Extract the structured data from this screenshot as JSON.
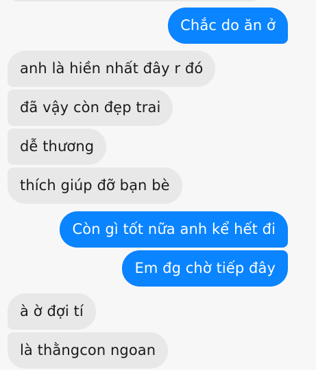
{
  "messages": [
    {
      "side": "outgoing",
      "text": "Chắc do ăn ở"
    },
    {
      "side": "incoming",
      "text": "anh là hiền nhất đây r đó"
    },
    {
      "side": "incoming",
      "text": "đã vậy còn đẹp trai"
    },
    {
      "side": "incoming",
      "text": "dễ thương"
    },
    {
      "side": "incoming",
      "text": "thích giúp đỡ bạn bè"
    },
    {
      "side": "outgoing",
      "text": "Còn gì tốt nữa anh kể hết đi"
    },
    {
      "side": "outgoing",
      "text": "Em đg chờ tiếp đây"
    },
    {
      "side": "incoming",
      "text": "à ờ đợi tí"
    },
    {
      "side": "incoming",
      "text": "là thằngcon ngoan"
    }
  ],
  "colors": {
    "outgoing_bubble": "#0a84ff",
    "incoming_bubble": "#e8e8e8",
    "background": "#f7f7f7"
  }
}
